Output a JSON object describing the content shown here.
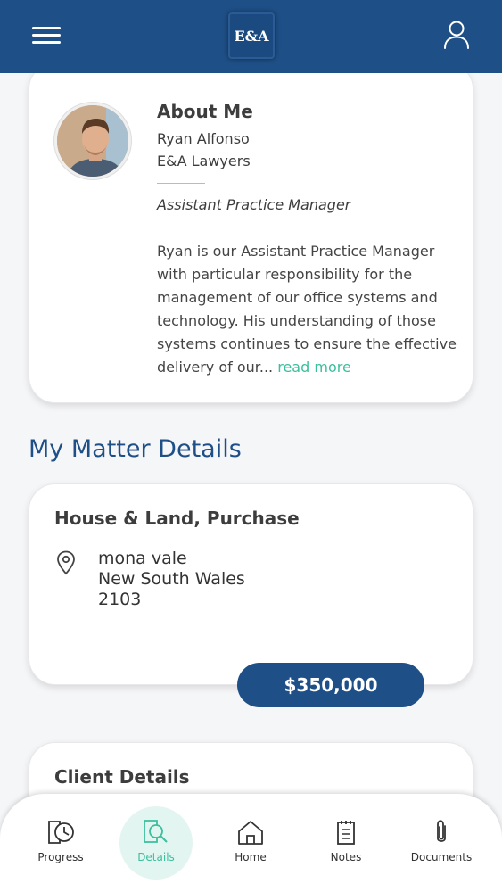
{
  "header": {
    "logo_text": "E&A",
    "menu_icon": "hamburger-icon",
    "profile_icon": "user-icon",
    "brand_color": "#1e4f86"
  },
  "about": {
    "title": "About Me",
    "name": "Ryan Alfonso",
    "firm": "E&A Lawyers",
    "role": "Assistant Practice Manager",
    "bio": "Ryan is our Assistant Practice Manager with particular responsibility for the management of our office systems and technology.  His understanding of those systems continues to ensure the effective delivery of our...",
    "read_more": "read more",
    "accent_color": "#3bbf9e"
  },
  "matter": {
    "section_title": "My Matter Details",
    "type": "House & Land, Purchase",
    "address_line1": "mona vale",
    "address_line2": "New South Wales",
    "address_line3": "2103",
    "price": "$350,000"
  },
  "client": {
    "title": "Client Details"
  },
  "nav": {
    "items": [
      {
        "label": "Progress",
        "icon": "progress-clock-icon"
      },
      {
        "label": "Details",
        "icon": "details-search-icon",
        "active": true
      },
      {
        "label": "Home",
        "icon": "home-icon"
      },
      {
        "label": "Notes",
        "icon": "notes-icon"
      },
      {
        "label": "Documents",
        "icon": "paperclip-icon"
      }
    ]
  }
}
